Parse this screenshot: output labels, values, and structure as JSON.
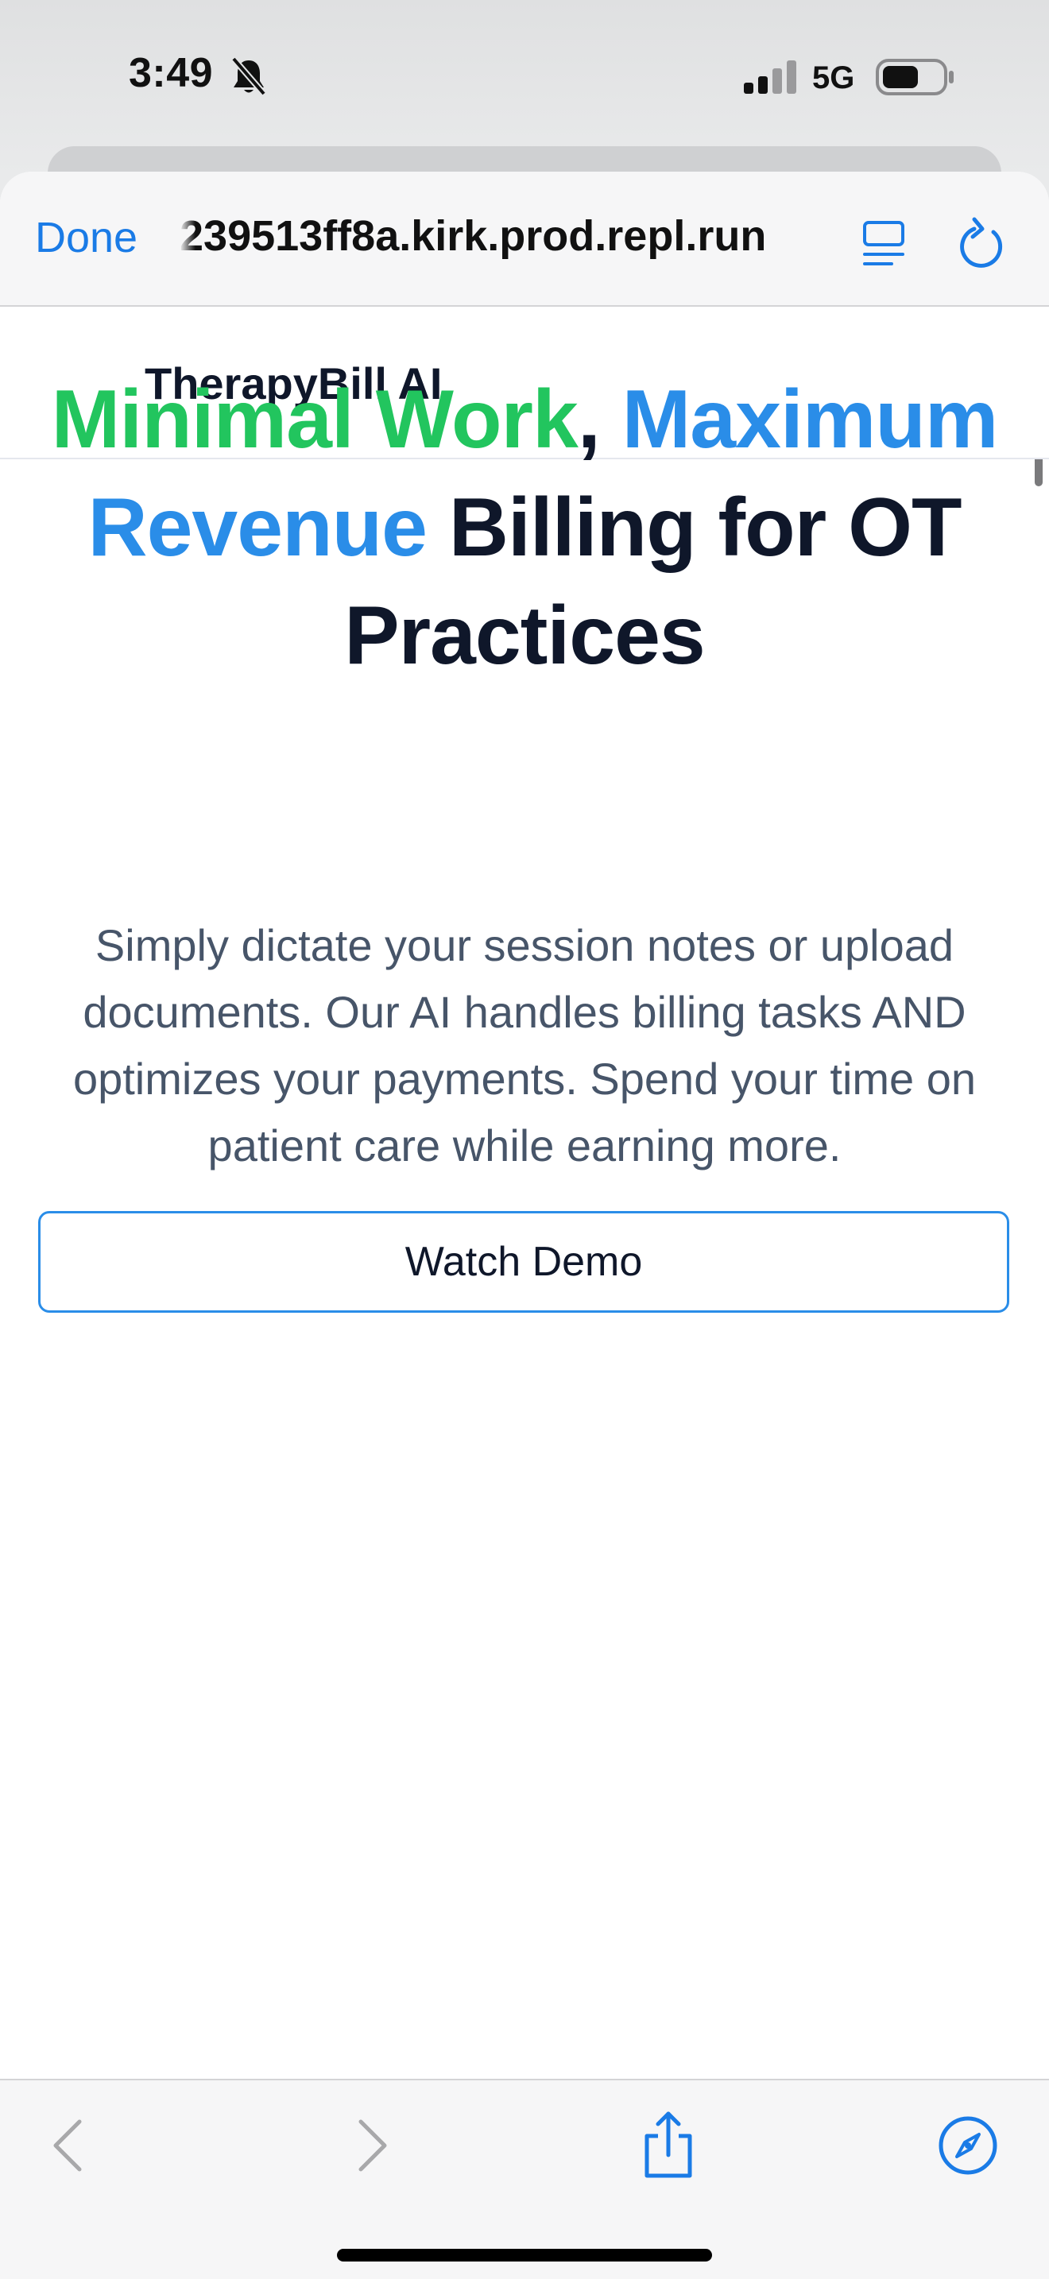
{
  "status_bar": {
    "time": "3:49",
    "network": "5G"
  },
  "browser": {
    "done_label": "Done",
    "url": "239513ff8a.kirk.prod.repl.run"
  },
  "site": {
    "brand": "TherapyBill AI",
    "hero": {
      "part1": "Minimal Work",
      "comma": ", ",
      "part2": "Maximum Revenue",
      "part3": " Billing for OT Practices"
    },
    "subtext": "Simply dictate your session notes or upload documents. Our AI handles billing tasks AND optimizes your payments. Spend your time on patient care while earning more.",
    "demo_button": "Watch Demo"
  },
  "colors": {
    "accent_blue": "#2a8de8",
    "accent_green": "#22c55e",
    "system_blue": "#1a7be6",
    "heading_dark": "#0f172a"
  },
  "icons": {
    "status": [
      "bell-slash-icon",
      "signal-icon",
      "battery-icon"
    ],
    "toolbar": [
      "reader-icon",
      "reload-icon"
    ],
    "bottom": [
      "back-icon",
      "forward-icon",
      "share-icon",
      "compass-icon"
    ]
  }
}
